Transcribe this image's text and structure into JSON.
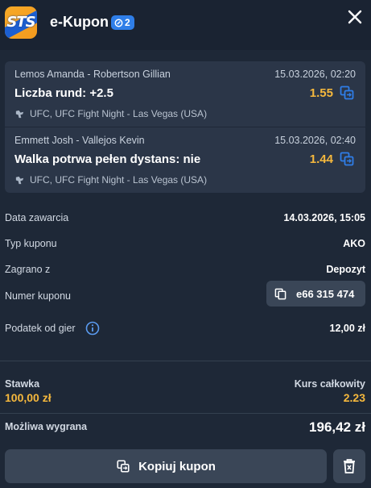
{
  "header": {
    "logo_text": "STS",
    "title": "e-Kupon",
    "badge_count": "2",
    "accent": "#2f7ee8"
  },
  "bets": [
    {
      "event": "Lemos Amanda - Robertson Gillian",
      "date": "15.03.2026, 02:20",
      "market": "Liczba rund: +2.5",
      "odds": "1.55",
      "league": "UFC, UFC Fight Night - Las Vegas (USA)"
    },
    {
      "event": "Emmett Josh - Vallejos Kevin",
      "date": "15.03.2026, 02:40",
      "market": "Walka potrwa pełen dystans: nie",
      "odds": "1.44",
      "league": "UFC, UFC Fight Night - Las Vegas (USA)"
    }
  ],
  "details": {
    "date_label": "Data zawarcia",
    "date_value": "14.03.2026, 15:05",
    "type_label": "Typ kuponu",
    "type_value": "AKO",
    "played_label": "Zagrano z",
    "played_value": "Depozyt",
    "number_label": "Numer kuponu",
    "number_value": "e66 315 474",
    "tax_label": "Podatek od gier",
    "tax_value": "12,00 zł"
  },
  "summary": {
    "stake_label": "Stawka",
    "stake_value": "100,00 zł",
    "total_odds_label": "Kurs całkowity",
    "total_odds_value": "2.23",
    "win_label": "Możliwa wygrana",
    "win_value": "196,42 zł"
  },
  "actions": {
    "copy_label": "Kopiuj kupon"
  },
  "colors": {
    "background": "#1e2837",
    "card": "#2b3648",
    "odds": "#f5b83d",
    "button": "#3a4657"
  }
}
